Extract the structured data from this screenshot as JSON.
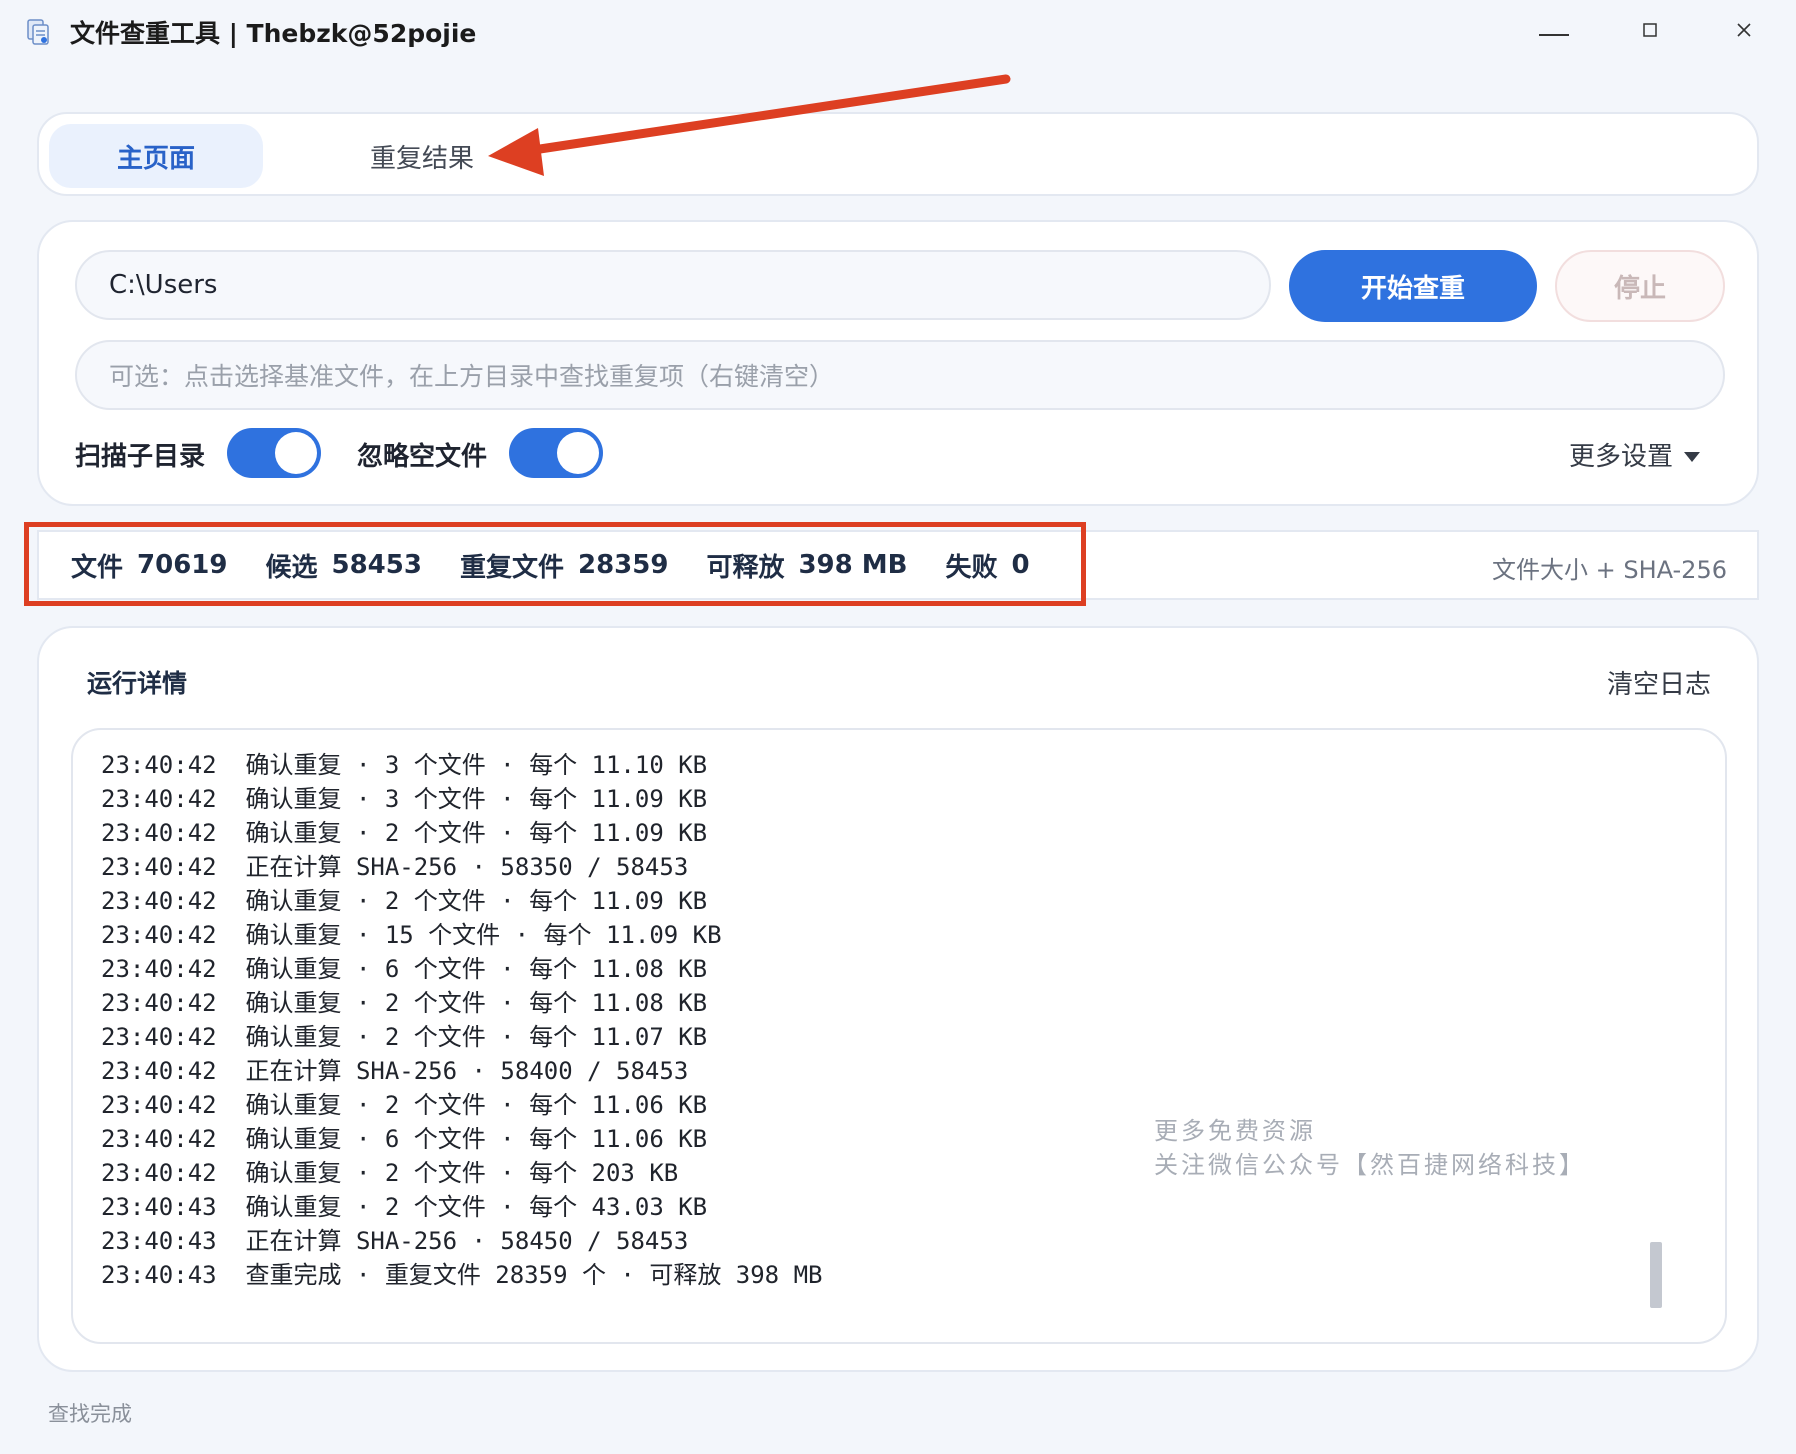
{
  "window": {
    "title": "文件查重工具 | Thebzk@52pojie"
  },
  "tabs": [
    {
      "label": "主页面",
      "active": true
    },
    {
      "label": "重复结果",
      "active": false
    }
  ],
  "controls": {
    "path_value": "C:\\Users",
    "start_label": "开始查重",
    "stop_label": "停止",
    "base_placeholder": "可选：点击选择基准文件，在上方目录中查找重复项（右键清空）",
    "toggles": [
      {
        "label": "扫描子目录",
        "on": true
      },
      {
        "label": "忽略空文件",
        "on": true
      }
    ],
    "more_settings": "更多设置"
  },
  "stats": {
    "items": [
      {
        "label": "文件",
        "value": "70619"
      },
      {
        "label": "候选",
        "value": "58453"
      },
      {
        "label": "重复文件",
        "value": "28359"
      },
      {
        "label": "可释放",
        "value": "398 MB"
      },
      {
        "label": "失败",
        "value": "0"
      }
    ],
    "algorithm": "文件大小 + SHA-256"
  },
  "log": {
    "title": "运行详情",
    "clear_label": "清空日志",
    "lines": [
      "23:40:42  确认重复 · 3 个文件 · 每个 11.10 KB",
      "23:40:42  确认重复 · 3 个文件 · 每个 11.09 KB",
      "23:40:42  确认重复 · 2 个文件 · 每个 11.09 KB",
      "23:40:42  正在计算 SHA-256 · 58350 / 58453",
      "23:40:42  确认重复 · 2 个文件 · 每个 11.09 KB",
      "23:40:42  确认重复 · 15 个文件 · 每个 11.09 KB",
      "23:40:42  确认重复 · 6 个文件 · 每个 11.08 KB",
      "23:40:42  确认重复 · 2 个文件 · 每个 11.08 KB",
      "23:40:42  确认重复 · 2 个文件 · 每个 11.07 KB",
      "23:40:42  正在计算 SHA-256 · 58400 / 58453",
      "23:40:42  确认重复 · 2 个文件 · 每个 11.06 KB",
      "23:40:42  确认重复 · 6 个文件 · 每个 11.06 KB",
      "23:40:42  确认重复 · 2 个文件 · 每个 203 KB",
      "23:40:43  确认重复 · 2 个文件 · 每个 43.03 KB",
      "23:40:43  正在计算 SHA-256 · 58450 / 58453",
      "23:40:43  查重完成 · 重复文件 28359 个 · 可释放 398 MB"
    ]
  },
  "watermark": {
    "line1": "更多免费资源",
    "line2": "关注微信公众号【然百捷网络科技】"
  },
  "status": "查找完成",
  "colors": {
    "accent": "#2f72df",
    "annotation": "#dd3f22"
  },
  "icons": {
    "app": "document-duplicate-icon",
    "minimize": "minimize-icon",
    "maximize": "maximize-icon",
    "close": "close-icon",
    "dropdown": "caret-down-icon"
  }
}
